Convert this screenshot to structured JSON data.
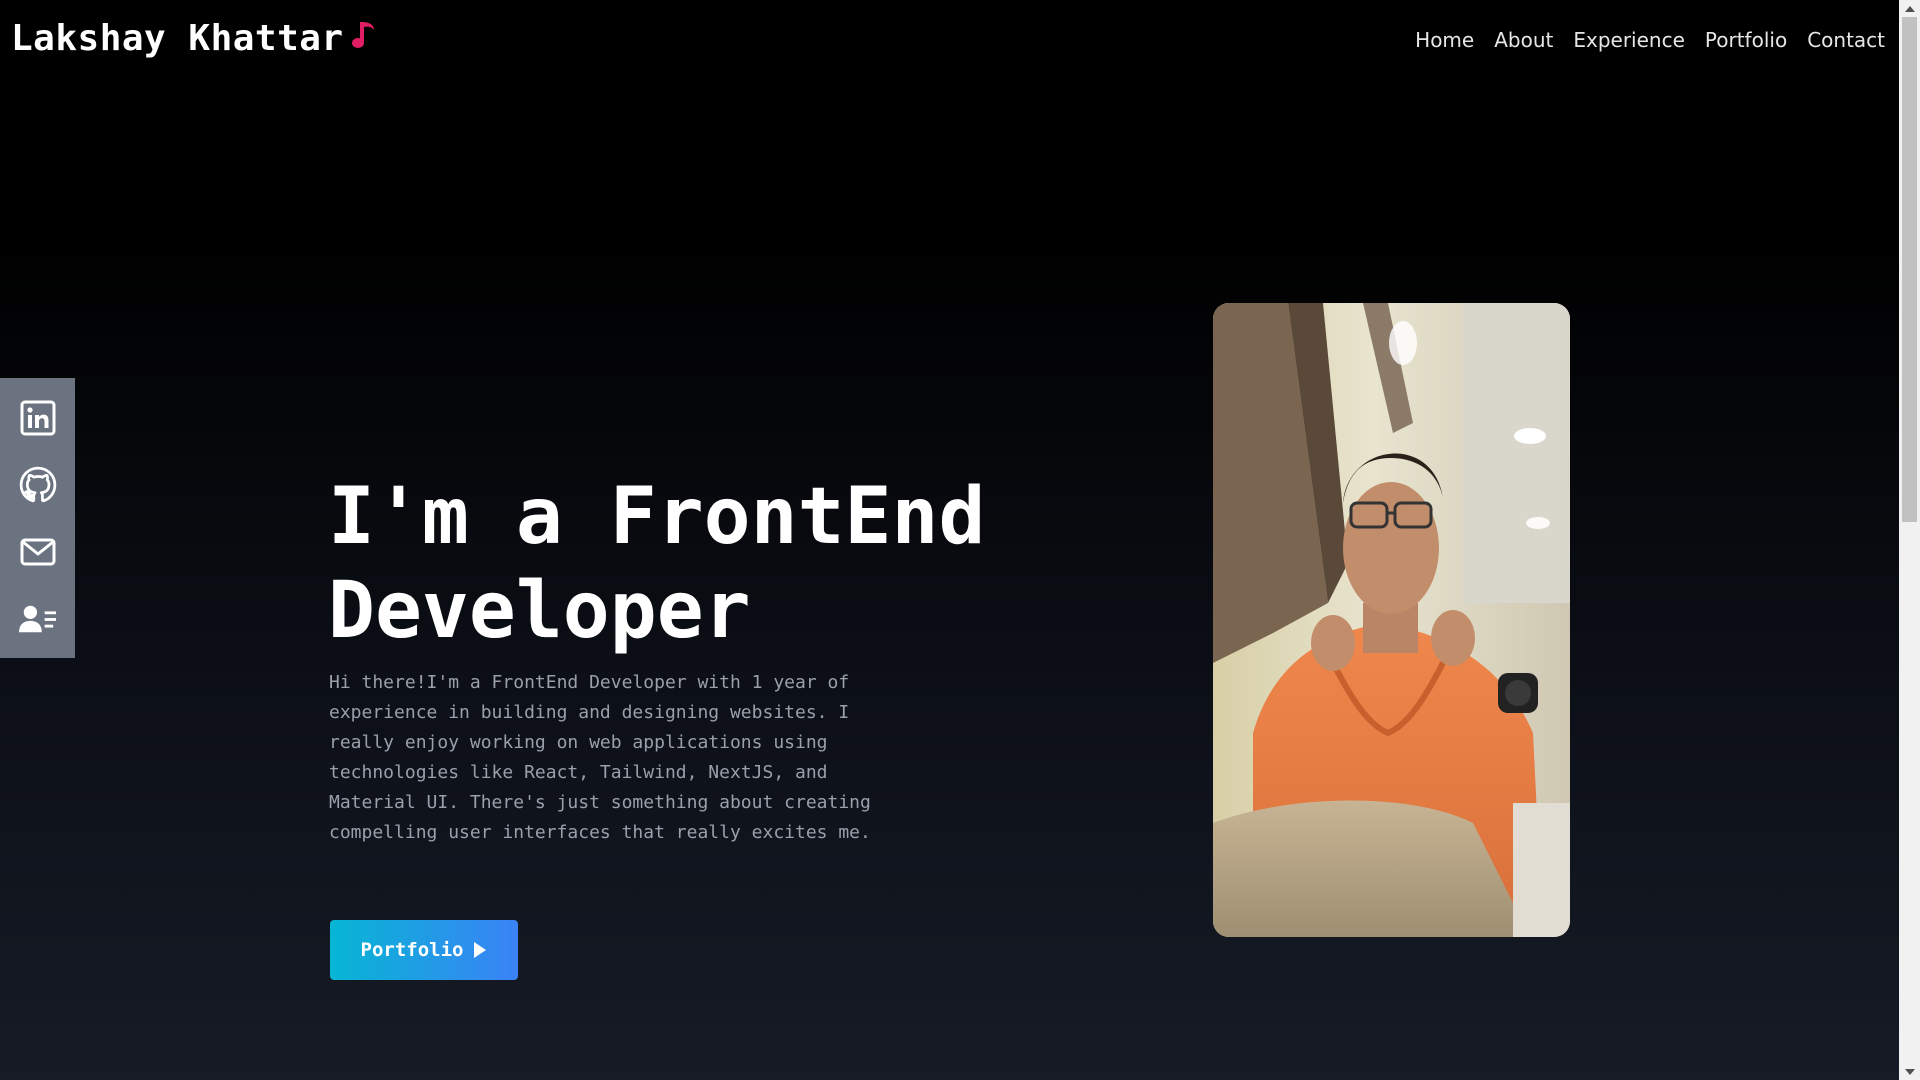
{
  "header": {
    "brand_name": "Lakshay Khattar",
    "brand_icon": "music-note-icon",
    "nav": [
      {
        "label": "Home"
      },
      {
        "label": "About"
      },
      {
        "label": "Experience"
      },
      {
        "label": "Portfolio"
      },
      {
        "label": "Contact"
      }
    ]
  },
  "social": {
    "icons": [
      "linkedin-icon",
      "github-icon",
      "mail-icon",
      "contact-card-icon"
    ]
  },
  "hero": {
    "title": "I'm a FrontEnd Developer",
    "description": "Hi there!I'm a FrontEnd Developer with 1 year of experience in building and designing websites. I really enjoy working on web applications using technologies like React, Tailwind, NextJS, and Material UI. There's just something about creating compelling user interfaces that really excites me.",
    "button_label": "Portfolio",
    "button_icon": "play-arrow-icon"
  },
  "colors": {
    "background_top": "#000000",
    "background_bottom": "#161b26",
    "accent_gradient_start": "#06b6d4",
    "accent_gradient_end": "#3b82f6",
    "note_icon": "#e11d64",
    "social_bar": "#6b7280",
    "body_text": "#9aa0aa"
  }
}
